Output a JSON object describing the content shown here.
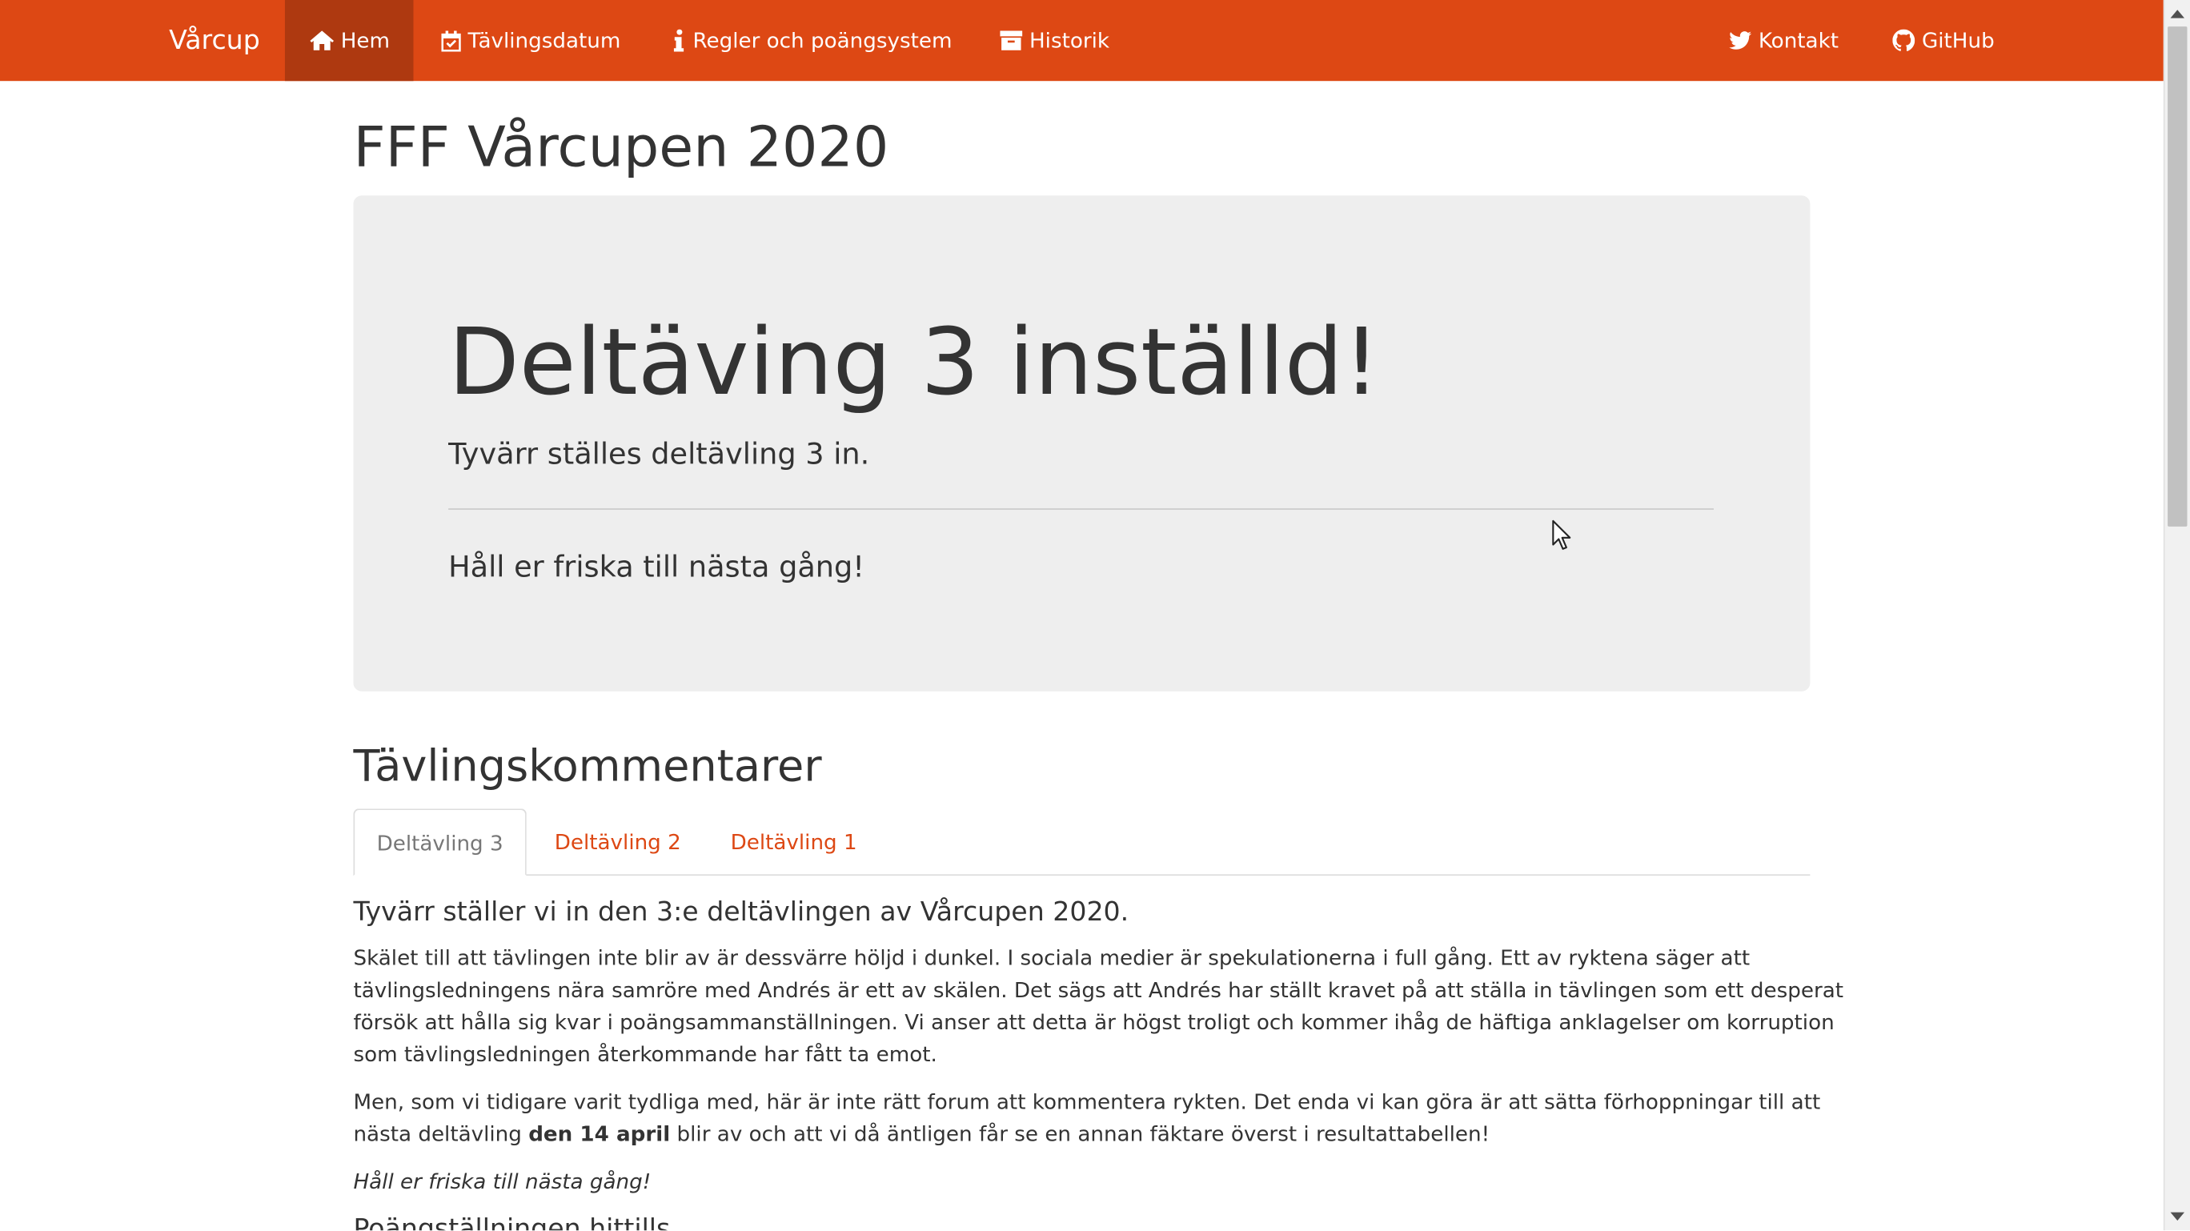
{
  "nav": {
    "brand": "Vårcup",
    "items": [
      {
        "label": "Hem",
        "icon": "home-icon",
        "active": true
      },
      {
        "label": "Tävlingsdatum",
        "icon": "calendar-check-icon"
      },
      {
        "label": "Regler och poängsystem",
        "icon": "info-icon"
      },
      {
        "label": "Historik",
        "icon": "archive-icon"
      }
    ],
    "right_items": [
      {
        "label": "Kontakt",
        "icon": "twitter-icon"
      },
      {
        "label": "GitHub",
        "icon": "github-icon"
      }
    ]
  },
  "page": {
    "title": "FFF Vårcupen 2020"
  },
  "jumbotron": {
    "title": "Deltäving 3 inställd!",
    "lead": "Tyvärr ställes deltävling 3 in.",
    "message": "Håll er friska till nästa gång!"
  },
  "comments": {
    "title": "Tävlingskommentarer",
    "tabs": [
      {
        "label": "Deltävling 3",
        "active": true
      },
      {
        "label": "Deltävling 2"
      },
      {
        "label": "Deltävling 1"
      }
    ],
    "heading": "Tyvärr ställer vi in den 3:e deltävlingen av Vårcupen 2020.",
    "paragraph1_lines": [
      "Skälet till att tävlingen inte blir av är dessvärre höljd i dunkel. I sociala medier är spekulationerna i full gång. Ett av ryktena säger att",
      "tävlingsledningens nära samröre med Andrés är ett av skälen. Det sägs att Andrés har ställt kravet på att ställa in tävlingen som ett desperat",
      "försök att hålla sig kvar i poängsammanställningen. Vi anser att detta är högst troligt och kommer ihåg de häftiga anklagelser om korruption",
      "som tävlingsledningen återkommande har fått ta emot."
    ],
    "paragraph2_line1": "Men, som vi tidigare varit tydliga med, här är inte rätt forum att kommentera rykten. Det enda vi kan göra är att sätta förhoppningar till att",
    "paragraph2_line2_pre": "nästa deltävling ",
    "paragraph2_line2_bold": "den 14 april",
    "paragraph2_line2_post": " blir av och att vi då äntligen får se en annan fäktare överst i resultattabellen!",
    "closing": "Håll er friska till nästa gång!",
    "next_heading": "Poängställningen hittills"
  },
  "colors": {
    "navbar": "#dd4814",
    "navbar_active": "#ae3910",
    "link": "#dd4814",
    "jumbotron_bg": "#eeeeee",
    "text": "#333333"
  }
}
